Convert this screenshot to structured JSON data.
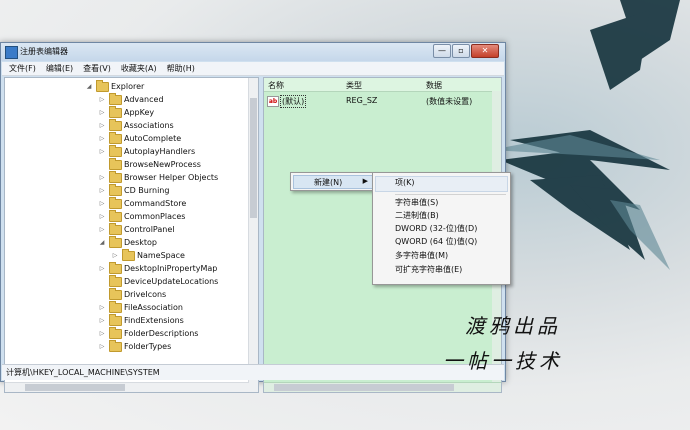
{
  "window": {
    "title": "注册表编辑器",
    "controls": [
      "—",
      "▫",
      "✕"
    ]
  },
  "menu": [
    "文件(F)",
    "编辑(E)",
    "查看(V)",
    "收藏夹(A)",
    "帮助(H)"
  ],
  "tree": {
    "root": "Explorer",
    "items": [
      "Advanced",
      "AppKey",
      "Associations",
      "AutoComplete",
      "AutoplayHandlers",
      "BrowseNewProcess",
      "Browser Helper Objects",
      "CD Burning",
      "CommandStore",
      "CommonPlaces",
      "ControlPanel",
      "Desktop",
      "NameSpace",
      "DesktopIniPropertyMap",
      "DeviceUpdateLocations",
      "DriveIcons",
      "FileAssociation",
      "FindExtensions",
      "FolderDescriptions",
      "FolderTypes"
    ]
  },
  "list": {
    "headers": [
      "名称",
      "类型",
      "数据"
    ],
    "rows": [
      {
        "name": "(默认)",
        "type": "REG_SZ",
        "data": "(数值未设置)"
      }
    ]
  },
  "status": "计算机\\HKEY_LOCAL_MACHINE\\SYSTEM",
  "context_menu": {
    "new": "新建(N)"
  },
  "submenu": [
    "项(K)",
    "字符串值(S)",
    "二进制值(B)",
    "DWORD (32-位)值(D)",
    "QWORD (64 位)值(Q)",
    "多字符串值(M)",
    "可扩充字符串值(E)"
  ],
  "overlay": {
    "line1": "渡鸦出品",
    "line2": "一帖一技术"
  }
}
